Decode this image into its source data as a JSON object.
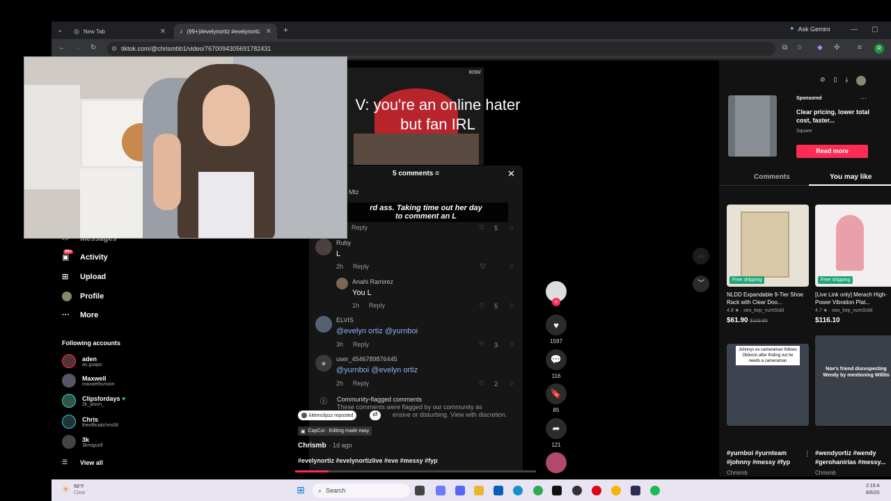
{
  "browser": {
    "tabs": [
      {
        "label": "New Tab"
      },
      {
        "label": "(99+)#evelynortiz #evelynortiz"
      }
    ],
    "new_tab": "+",
    "ask_gemini": "Ask Gemini",
    "url": "tiktok.com/@chrismbb1/video/7670094305691782431"
  },
  "video": {
    "counter": "8098/",
    "caption": "V: you're an online hater but fan IRL"
  },
  "comments": {
    "header": "5 comments",
    "list": [
      {
        "name": "t Mtz",
        "overlay_line1": "rd ass. Taking time out her day",
        "overlay_line2": "to comment an L",
        "time": "",
        "reply": "Reply",
        "likes": "5"
      },
      {
        "name": "Ruby",
        "text": "L",
        "time": "2h",
        "reply": "Reply",
        "likes": ""
      },
      {
        "name": "Anahi Ramirez",
        "text": "You L",
        "time": "1h",
        "reply": "Reply",
        "likes": "5"
      },
      {
        "name": "ELVIS",
        "text": "@evelyn ortiz @yurnboi",
        "time": "3h",
        "reply": "Reply",
        "likes": "3"
      },
      {
        "name": "user_4546789876445",
        "text": "@yurnboi @evelyn ortiz",
        "time": "2h",
        "reply": "Reply",
        "likes": "2"
      }
    ],
    "flagged_title": "Community-flagged comments",
    "flagged_line1": "These comments were flagged by our community as",
    "flagged_line2": "ensive or disturbing. View with discretion."
  },
  "post": {
    "reposted": "kittenclipzz reposted",
    "capcut": "CapCut · Editing made easy",
    "author": "Chrismb",
    "time": "· 1d ago",
    "hashtags": "#evelynortiz #evelynortizlive #eve #messy #fyp"
  },
  "actions": {
    "likes": "1597",
    "comments": "116",
    "saves": "85",
    "shares": "121"
  },
  "sidebar": {
    "messages": "Messages",
    "activity": "Activity",
    "activity_badge": "99+",
    "upload": "Upload",
    "profile": "Profile",
    "more": "More",
    "following_header": "Following accounts",
    "following": [
      {
        "name": "aden",
        "handle": "as.guapo"
      },
      {
        "name": "Maxwell",
        "handle": "maxwellsvision"
      },
      {
        "name": "Clipsfordays",
        "handle": "2k_jason_"
      },
      {
        "name": "Chris",
        "handle": "theofficialchris08"
      },
      {
        "name": "3k",
        "handle": "3kmiguell"
      }
    ],
    "view_all": "View all"
  },
  "right": {
    "sponsored": "Sponsored",
    "ad_text": "Clear pricing, lower total cost, faster...",
    "ad_brand": "Square",
    "read_more": "Read more",
    "tab_comments": "Comments",
    "tab_you_may_like": "You may like",
    "products": [
      {
        "ship": "Free shipping",
        "title": "NLDD Expandable 9-Tier Shoe Rack with Clear Doo...",
        "rating": "4.8 ★ · seo_kep_numSold",
        "price": "$61.90",
        "old": "$123.80"
      },
      {
        "ship": "Free shipping",
        "title": "[Live Link only] Merach High-Power Vibration Plat...",
        "rating": "4.7 ★ · seo_kep_numSold",
        "price": "$116.10",
        "old": ""
      }
    ],
    "videos": [
      {
        "overlay": "Johnnys ex cameraman follows Oblivion after finding out he needs a cameraman",
        "tags": "#yurnboi #yurnteam #johnny #messy #fyp",
        "author": "Chrismb"
      },
      {
        "overlay": "Noe's friend disrespecting Wendy by mentioning Willito",
        "tags": "#wendyortiz #wendy #gerohanirias #messy...",
        "author": "Chrismb"
      }
    ]
  },
  "taskbar": {
    "temp": "68°F",
    "weather": "Clear",
    "search": "Search",
    "time": "2:19 A",
    "date": "8/6/20"
  }
}
